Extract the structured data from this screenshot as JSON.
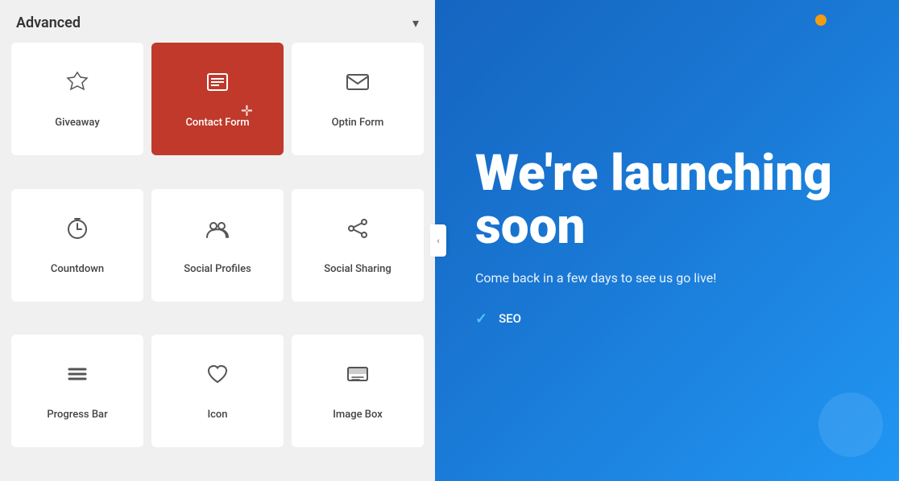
{
  "panel": {
    "title": "Advanced",
    "collapse_icon": "chevron-down",
    "collapse_label": "▾"
  },
  "grid_items": [
    {
      "id": "giveaway",
      "label": "Giveaway",
      "icon": "giveaway",
      "active": false
    },
    {
      "id": "contact-form",
      "label": "Contact Form",
      "icon": "contact",
      "active": true
    },
    {
      "id": "optin-form",
      "label": "Optin Form",
      "icon": "optin",
      "active": false
    },
    {
      "id": "countdown",
      "label": "Countdown",
      "icon": "countdown",
      "active": false
    },
    {
      "id": "social-profiles",
      "label": "Social Profiles",
      "icon": "profiles",
      "active": false
    },
    {
      "id": "social-sharing",
      "label": "Social Sharing",
      "icon": "sharing",
      "active": false
    },
    {
      "id": "progress-bar",
      "label": "Progress Bar",
      "icon": "progress",
      "active": false
    },
    {
      "id": "icon",
      "label": "Icon",
      "icon": "icon-heart",
      "active": false
    },
    {
      "id": "image-box",
      "label": "Image Box",
      "icon": "imagebox",
      "active": false
    }
  ],
  "preview": {
    "heading": "We're launching soon",
    "subtext": "Come back in a few days to see us go live!",
    "features": [
      "SEO"
    ],
    "accent_color": "#f39c12"
  }
}
